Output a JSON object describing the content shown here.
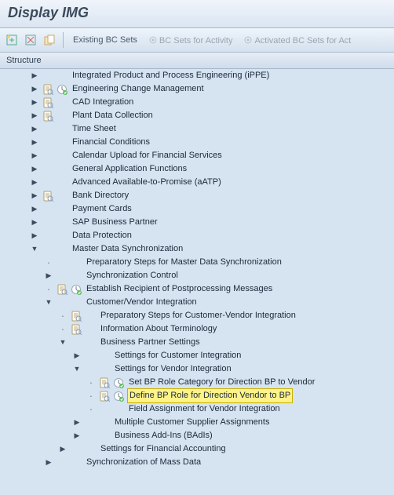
{
  "title": "Display IMG",
  "toolbar": {
    "existing_bc": "Existing BC Sets",
    "bc_for_activity": "BC Sets for Activity",
    "activated_bc": "Activated BC Sets for Act"
  },
  "structure_label": "Structure",
  "tree": [
    {
      "indent": 2,
      "expand": "r",
      "doc": false,
      "act": false,
      "label": "Integrated Product and Process Engineering (iPPE)"
    },
    {
      "indent": 2,
      "expand": "r",
      "doc": true,
      "act": true,
      "label": "Engineering Change Management"
    },
    {
      "indent": 2,
      "expand": "r",
      "doc": true,
      "act": false,
      "label": "CAD Integration"
    },
    {
      "indent": 2,
      "expand": "r",
      "doc": true,
      "act": false,
      "label": "Plant Data Collection"
    },
    {
      "indent": 2,
      "expand": "r",
      "doc": false,
      "act": false,
      "label": "Time Sheet"
    },
    {
      "indent": 2,
      "expand": "r",
      "doc": false,
      "act": false,
      "label": "Financial Conditions"
    },
    {
      "indent": 2,
      "expand": "r",
      "doc": false,
      "act": false,
      "label": "Calendar Upload for Financial Services"
    },
    {
      "indent": 2,
      "expand": "r",
      "doc": false,
      "act": false,
      "label": "General Application Functions"
    },
    {
      "indent": 2,
      "expand": "r",
      "doc": false,
      "act": false,
      "label": "Advanced Available-to-Promise (aATP)"
    },
    {
      "indent": 2,
      "expand": "r",
      "doc": true,
      "act": false,
      "label": "Bank Directory"
    },
    {
      "indent": 2,
      "expand": "r",
      "doc": false,
      "act": false,
      "label": "Payment Cards"
    },
    {
      "indent": 2,
      "expand": "r",
      "doc": false,
      "act": false,
      "label": "SAP Business Partner"
    },
    {
      "indent": 2,
      "expand": "r",
      "doc": false,
      "act": false,
      "label": "Data Protection"
    },
    {
      "indent": 2,
      "expand": "d",
      "doc": false,
      "act": false,
      "label": "Master Data Synchronization"
    },
    {
      "indent": 3,
      "expand": "dot",
      "doc": false,
      "act": false,
      "label": "Preparatory Steps for Master Data Synchronization"
    },
    {
      "indent": 3,
      "expand": "r",
      "doc": false,
      "act": false,
      "label": "Synchronization Control"
    },
    {
      "indent": 3,
      "expand": "dot",
      "doc": true,
      "act": true,
      "label": "Establish Recipient of Postprocessing Messages"
    },
    {
      "indent": 3,
      "expand": "d",
      "doc": false,
      "act": false,
      "label": "Customer/Vendor Integration"
    },
    {
      "indent": 4,
      "expand": "dot",
      "doc": true,
      "act": false,
      "label": "Preparatory Steps for Customer-Vendor Integration"
    },
    {
      "indent": 4,
      "expand": "dot",
      "doc": true,
      "act": false,
      "label": "Information About Terminology"
    },
    {
      "indent": 4,
      "expand": "d",
      "doc": false,
      "act": false,
      "label": "Business Partner Settings"
    },
    {
      "indent": 5,
      "expand": "r",
      "doc": false,
      "act": false,
      "label": "Settings for Customer Integration"
    },
    {
      "indent": 5,
      "expand": "d",
      "doc": false,
      "act": false,
      "label": "Settings for Vendor Integration"
    },
    {
      "indent": 6,
      "expand": "dot",
      "doc": true,
      "act": true,
      "label": "Set BP Role Category for Direction BP to Vendor"
    },
    {
      "indent": 6,
      "expand": "dot",
      "doc": true,
      "act": true,
      "label": "Define BP Role for Direction Vendor to BP",
      "highlight": true
    },
    {
      "indent": 6,
      "expand": "dot",
      "doc": false,
      "act": false,
      "label": "Field Assignment for Vendor Integration"
    },
    {
      "indent": 5,
      "expand": "r",
      "doc": false,
      "act": false,
      "label": "Multiple Customer Supplier Assignments"
    },
    {
      "indent": 5,
      "expand": "r",
      "doc": false,
      "act": false,
      "label": "Business Add-Ins (BAdIs)"
    },
    {
      "indent": 4,
      "expand": "r",
      "doc": false,
      "act": false,
      "label": "Settings for Financial Accounting"
    },
    {
      "indent": 3,
      "expand": "r",
      "doc": false,
      "act": false,
      "label": "Synchronization of Mass Data"
    }
  ]
}
